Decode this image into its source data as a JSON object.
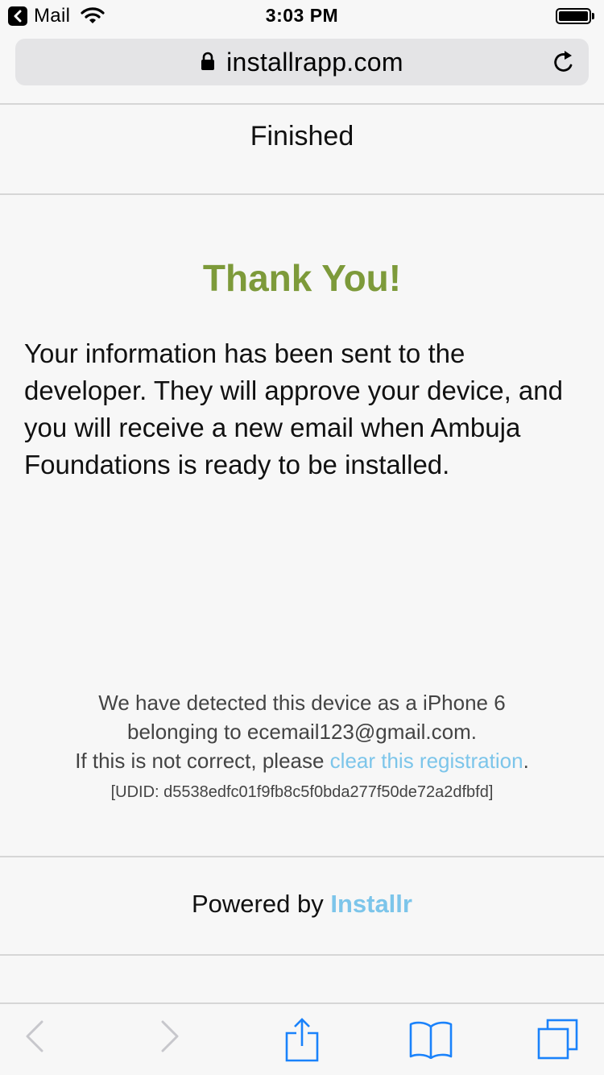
{
  "status_bar": {
    "back_app_label": "Mail",
    "time": "3:03 PM"
  },
  "browser": {
    "url": "installrapp.com"
  },
  "page": {
    "heading": "Finished",
    "thank_you": "Thank You!",
    "message": "Your information has been sent to the developer. They will approve your device, and you will receive a new email when Ambuja Foundations is ready to be installed.",
    "device_line1": "We have detected this device as a iPhone 6",
    "device_line2": "belonging to ecemail123@gmail.com.",
    "device_line3_prefix": "If this is not correct, please ",
    "clear_link": "clear this registration",
    "device_line3_suffix": ".",
    "udid": "[UDID: d5538edfc01f9fb8c5f0bda277f50de72a2dfbfd]",
    "powered_prefix": "Powered by ",
    "powered_brand": "Installr"
  },
  "colors": {
    "thank_you": "#7d9a3a",
    "link": "#7cc5ea",
    "ios_blue": "#1a82fb",
    "disabled": "#c7c7cc"
  },
  "toolbar_icons": [
    "back-icon",
    "forward-icon",
    "share-icon",
    "bookmarks-icon",
    "tabs-icon"
  ]
}
